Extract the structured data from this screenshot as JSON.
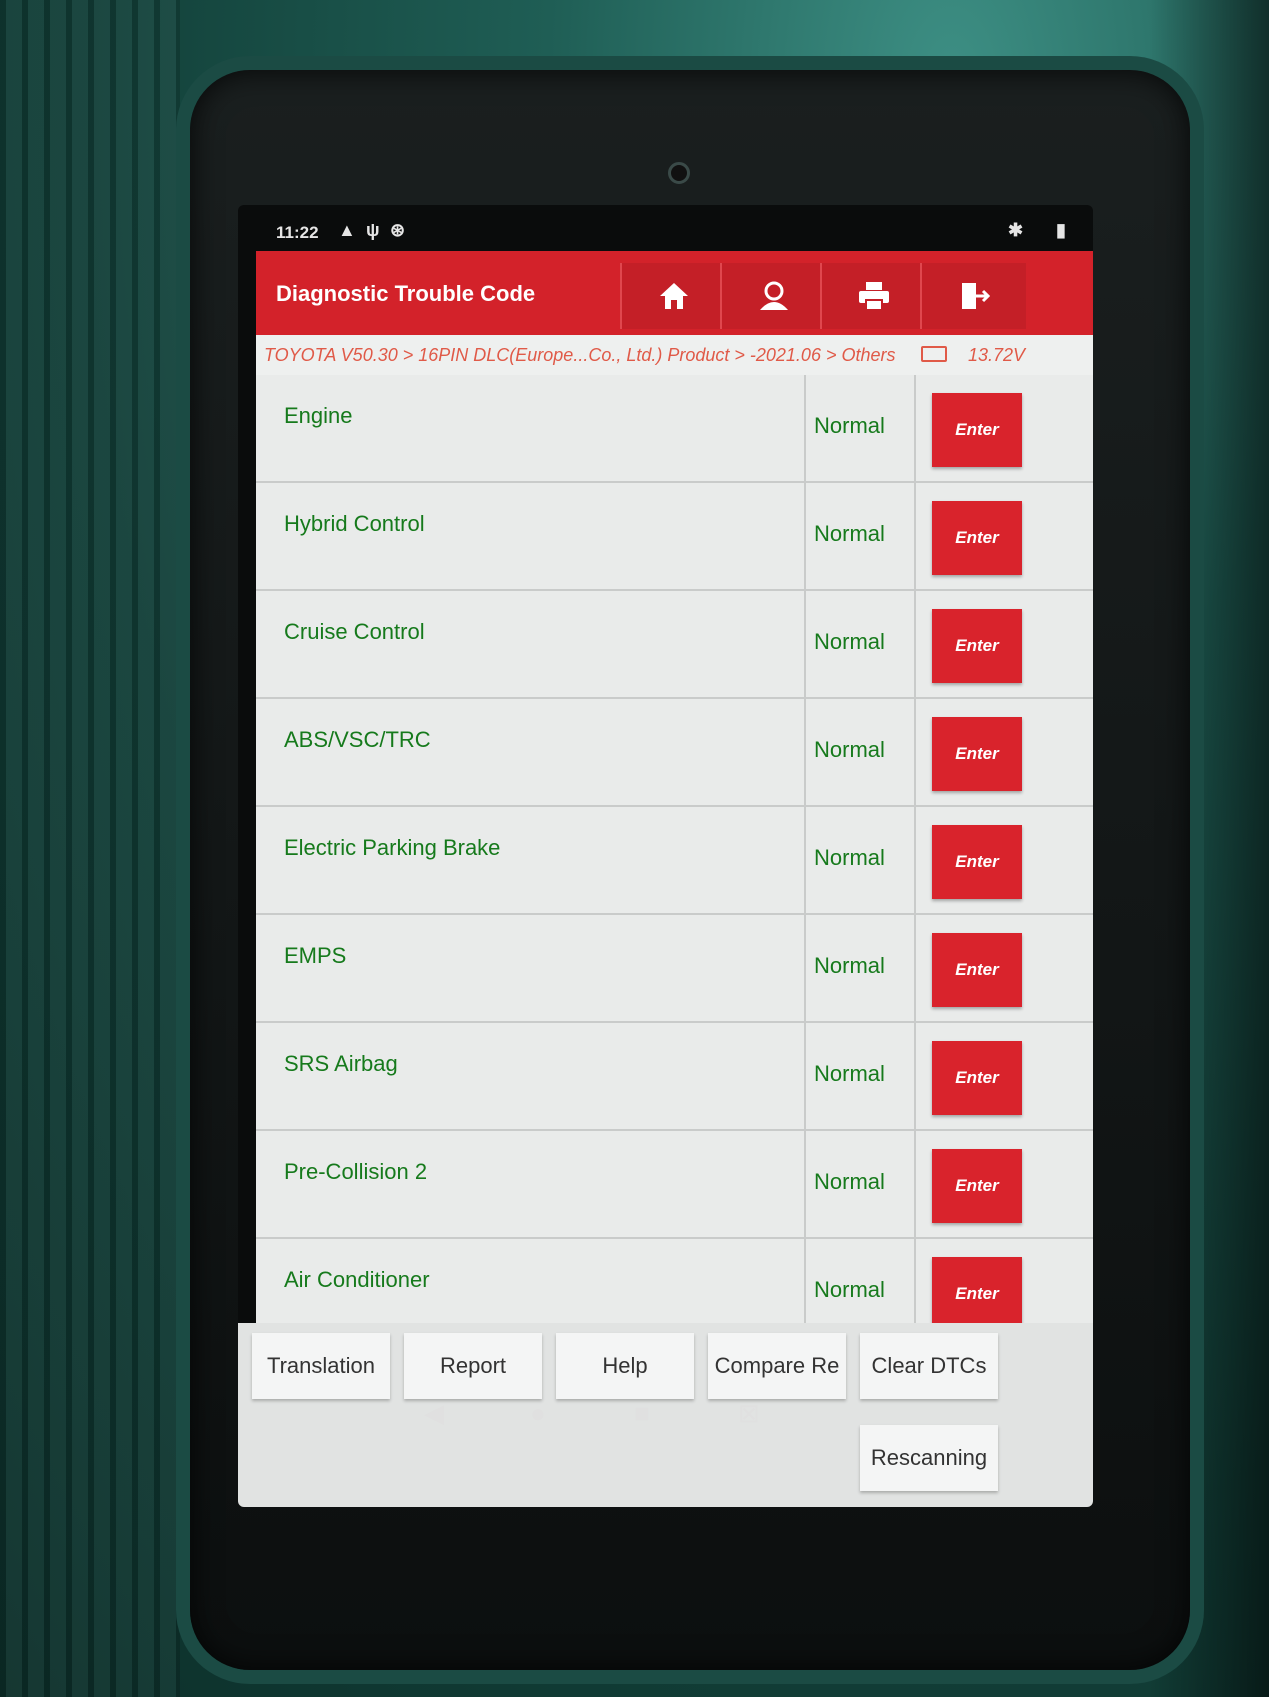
{
  "status_bar": {
    "time": "11:22",
    "icons": [
      "signal-icon",
      "warning-icon",
      "usb-icon",
      "settings-icon",
      "bluetooth-icon",
      "battery-icon"
    ]
  },
  "header": {
    "title": "Diagnostic Trouble Code",
    "toolbar": [
      "home-icon",
      "user-icon",
      "print-icon",
      "exit-icon"
    ]
  },
  "breadcrumb": {
    "path": "TOYOTA V50.30 > 16PIN DLC(Europe...Co., Ltd.) Product > -2021.06 > Others",
    "voltage": "13.72V"
  },
  "systems": [
    {
      "name": "Engine",
      "status": "Normal",
      "action": "Enter"
    },
    {
      "name": "Hybrid Control",
      "status": "Normal",
      "action": "Enter"
    },
    {
      "name": "Cruise Control",
      "status": "Normal",
      "action": "Enter"
    },
    {
      "name": "ABS/VSC/TRC",
      "status": "Normal",
      "action": "Enter"
    },
    {
      "name": "Electric Parking Brake",
      "status": "Normal",
      "action": "Enter"
    },
    {
      "name": "EMPS",
      "status": "Normal",
      "action": "Enter"
    },
    {
      "name": "SRS Airbag",
      "status": "Normal",
      "action": "Enter"
    },
    {
      "name": "Pre-Collision 2",
      "status": "Normal",
      "action": "Enter"
    },
    {
      "name": "Air Conditioner",
      "status": "Normal",
      "action": "Enter"
    }
  ],
  "footer": {
    "translation": "Translation",
    "report": "Report",
    "help": "Help",
    "compare": "Compare Re",
    "clear_dtcs": "Clear DTCs",
    "rescanning": "Rescanning"
  },
  "colors": {
    "header_red": "#d3222a",
    "system_green": "#167a1c",
    "breadcrumb_orange": "#e05a48"
  }
}
